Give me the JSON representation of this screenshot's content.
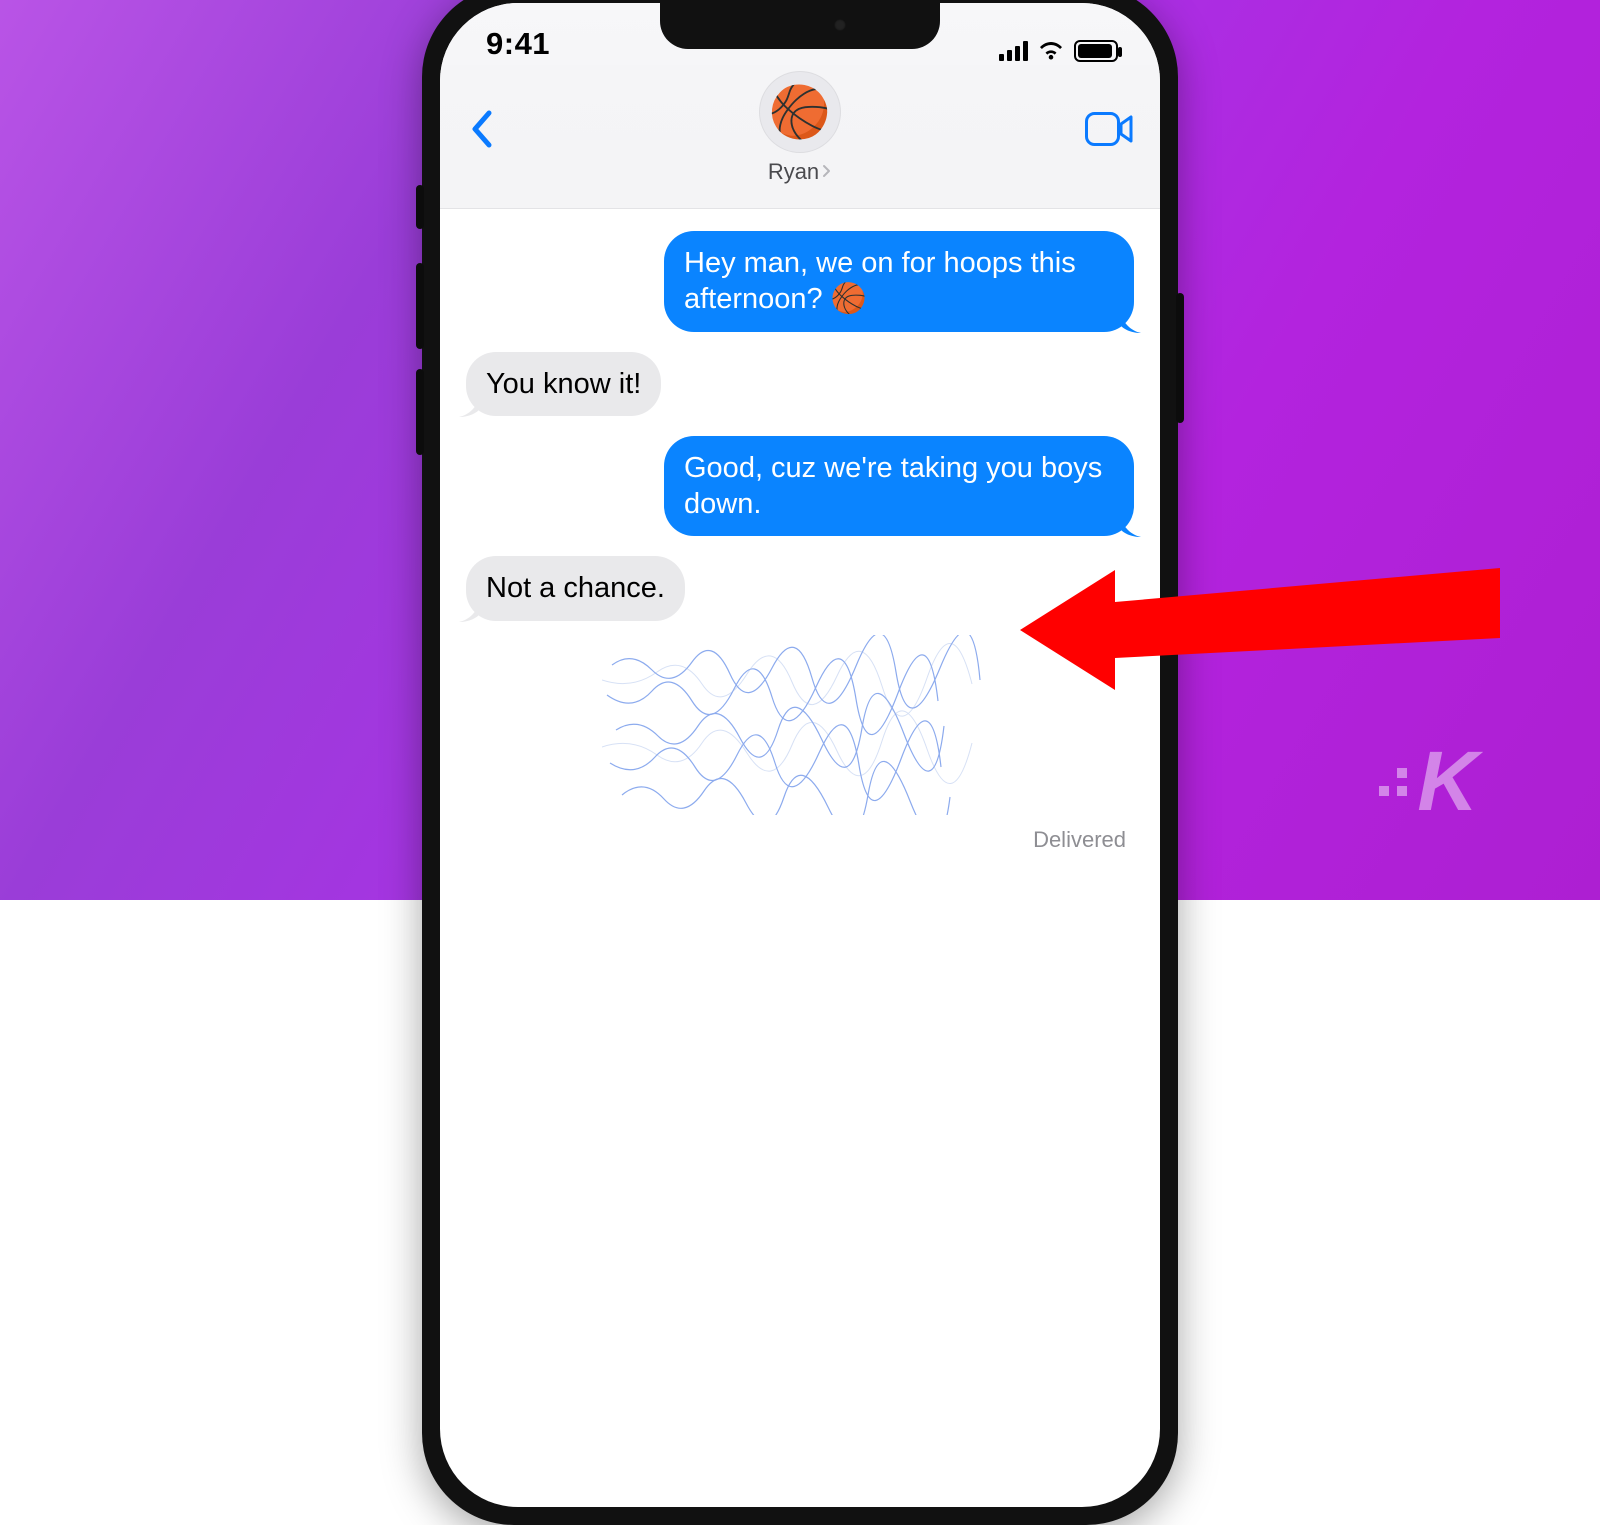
{
  "statusbar": {
    "time": "9:41"
  },
  "header": {
    "contact_name": "Ryan",
    "avatar_emoji": "🏀"
  },
  "messages": [
    {
      "side": "sent",
      "text": "Hey man, we on for hoops this afternoon? 🏀"
    },
    {
      "side": "recv",
      "text": "You know it!"
    },
    {
      "side": "sent",
      "text": "Good, cuz we're taking you boys down."
    },
    {
      "side": "recv",
      "text": "Not a chance."
    }
  ],
  "delivered_label": "Delivered",
  "watermark": "K",
  "colors": {
    "ios_blue": "#0a84ff",
    "bubble_gray": "#e9e9eb",
    "link_blue": "#0a7aff",
    "arrow_red": "#ff0000"
  }
}
